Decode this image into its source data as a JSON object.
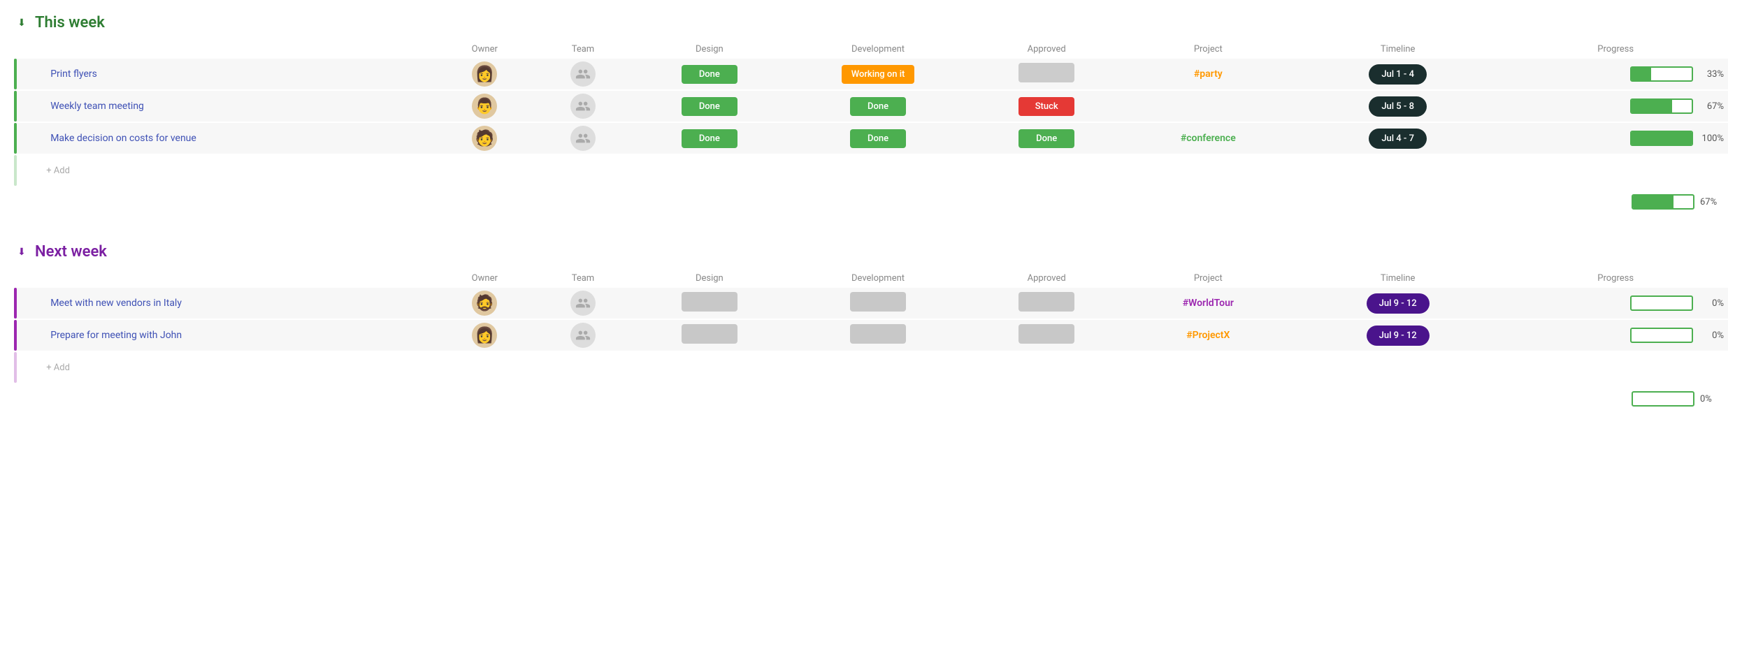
{
  "thisWeek": {
    "title": "This week",
    "color": "green",
    "columns": {
      "owner": "Owner",
      "team": "Team",
      "design": "Design",
      "development": "Development",
      "approved": "Approved",
      "project": "Project",
      "timeline": "Timeline",
      "progress": "Progress"
    },
    "rows": [
      {
        "id": 1,
        "task": "Print flyers",
        "owner": "👩",
        "team": "👥",
        "design": "Done",
        "designStatus": "done",
        "development": "Working on it",
        "devStatus": "working",
        "approved": "",
        "approvedStatus": "empty",
        "project": "#party",
        "projectColor": "orange",
        "timeline": "Jul 1 - 4",
        "timelineColor": "dark",
        "progressPct": 33
      },
      {
        "id": 2,
        "task": "Weekly team meeting",
        "owner": "👨",
        "team": "👥",
        "design": "Done",
        "designStatus": "done",
        "development": "Done",
        "devStatus": "done",
        "approved": "Stuck",
        "approvedStatus": "stuck",
        "project": "",
        "projectColor": "",
        "timeline": "Jul 5 - 8",
        "timelineColor": "dark",
        "progressPct": 67
      },
      {
        "id": 3,
        "task": "Make decision on costs for venue",
        "owner": "🧑",
        "team": "👥",
        "design": "Done",
        "designStatus": "done",
        "development": "Done",
        "devStatus": "done",
        "approved": "Done",
        "approvedStatus": "done",
        "project": "#conference",
        "projectColor": "green",
        "timeline": "Jul 4 - 7",
        "timelineColor": "dark",
        "progressPct": 100
      }
    ],
    "addLabel": "+ Add",
    "summaryPct": 67,
    "summaryProgressPct": 67
  },
  "nextWeek": {
    "title": "Next week",
    "color": "purple",
    "columns": {
      "owner": "Owner",
      "team": "Team",
      "design": "Design",
      "development": "Development",
      "approved": "Approved",
      "project": "Project",
      "timeline": "Timeline",
      "progress": "Progress"
    },
    "rows": [
      {
        "id": 1,
        "task": "Meet with new vendors in Italy",
        "owner": "🧔",
        "team": "👥",
        "design": "",
        "designStatus": "empty-gray",
        "development": "",
        "devStatus": "empty-gray",
        "approved": "",
        "approvedStatus": "empty-gray",
        "project": "#WorldTour",
        "projectColor": "purple",
        "timeline": "Jul 9 - 12",
        "timelineColor": "purple",
        "progressPct": 0
      },
      {
        "id": 2,
        "task": "Prepare for meeting with John",
        "owner": "👩",
        "team": "👥",
        "design": "",
        "designStatus": "empty-gray",
        "development": "",
        "devStatus": "empty-gray",
        "approved": "",
        "approvedStatus": "empty-gray",
        "project": "#ProjectX",
        "projectColor": "black",
        "timeline": "Jul 9 - 12",
        "timelineColor": "purple",
        "progressPct": 0
      }
    ],
    "addLabel": "+ Add",
    "summaryPct": 0,
    "summaryProgressPct": 0
  }
}
